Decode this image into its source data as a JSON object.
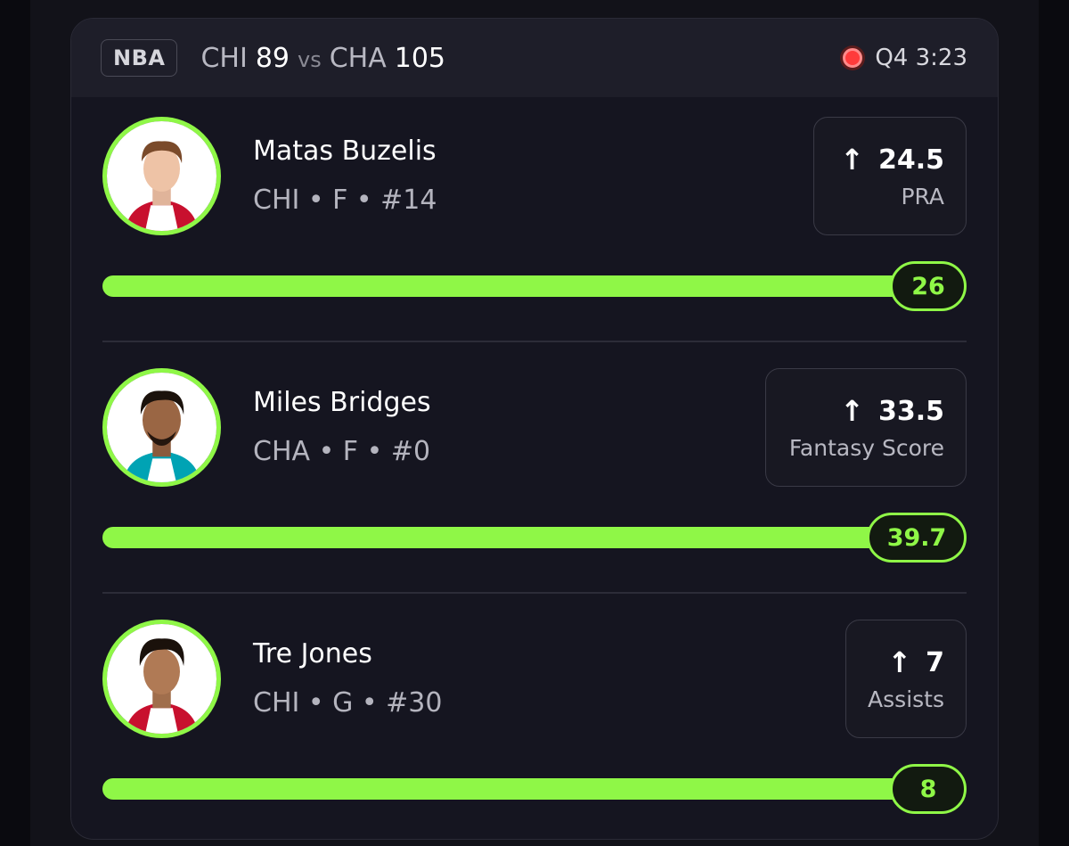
{
  "game": {
    "league": "NBA",
    "away_team": "CHI",
    "away_score": "89",
    "vs": "vs",
    "home_team": "CHA",
    "home_score": "105",
    "status": "Q4 3:23"
  },
  "players": [
    {
      "name": "Matas Buzelis",
      "meta": "CHI • F • #14",
      "line": "24.5",
      "stat": "PRA",
      "actual": "26",
      "progress": 1.0,
      "jersey_color": "#c8102e"
    },
    {
      "name": "Miles Bridges",
      "meta": "CHA • F • #0",
      "line": "33.5",
      "stat": "Fantasy Score",
      "actual": "39.7",
      "progress": 1.0,
      "jersey_color": "#00788c"
    },
    {
      "name": "Tre Jones",
      "meta": "CHI • G • #30",
      "line": "7",
      "stat": "Assists",
      "actual": "8",
      "progress": 1.0,
      "jersey_color": "#c8102e"
    }
  ],
  "colors": {
    "accent": "#8ff747",
    "live": "#ff3b3b",
    "background": "#121219",
    "card": "#151520"
  },
  "icons": {
    "over": "arrow-up-icon",
    "live": "live-dot-icon"
  }
}
